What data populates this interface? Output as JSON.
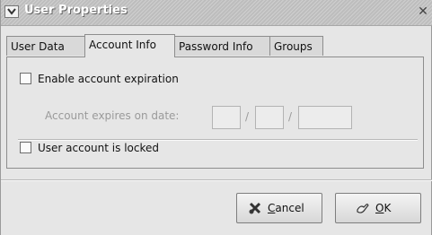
{
  "window": {
    "title": "User Properties",
    "menu_icon": "chevron-down-icon",
    "close_icon": "close-icon"
  },
  "tabs": [
    {
      "label": "User Data"
    },
    {
      "label": "Account Info"
    },
    {
      "label": "Password Info"
    },
    {
      "label": "Groups"
    }
  ],
  "active_tab": "Account Info",
  "account_info": {
    "enable_expiration": {
      "label": "Enable account expiration",
      "checked": false
    },
    "expires_on": {
      "label": "Account expires on date:",
      "separator": "/",
      "month": "",
      "day": "",
      "year": "",
      "disabled": true
    },
    "account_locked": {
      "label": "User account is locked",
      "checked": false
    }
  },
  "buttons": {
    "cancel": {
      "mnemonic": "C",
      "rest": "ancel",
      "icon": "cancel-x-icon"
    },
    "ok": {
      "mnemonic": "O",
      "rest": "K",
      "icon": "ok-hand-icon"
    }
  },
  "colors": {
    "window_bg": "#e6e6e6",
    "titlebar": "#c9c9c9",
    "disabled_text": "#9a9a9a"
  }
}
